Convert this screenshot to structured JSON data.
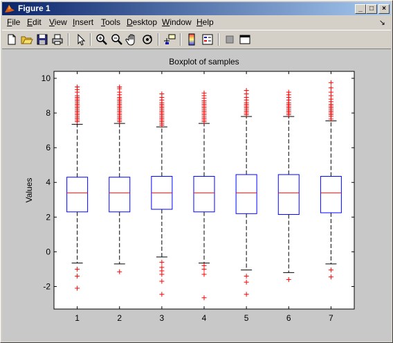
{
  "window": {
    "title": "Figure 1"
  },
  "menu": [
    {
      "pre": "",
      "ul": "F",
      "post": "ile"
    },
    {
      "pre": "",
      "ul": "E",
      "post": "dit"
    },
    {
      "pre": "",
      "ul": "V",
      "post": "iew"
    },
    {
      "pre": "",
      "ul": "I",
      "post": "nsert"
    },
    {
      "pre": "",
      "ul": "T",
      "post": "ools"
    },
    {
      "pre": "",
      "ul": "D",
      "post": "esktop"
    },
    {
      "pre": "",
      "ul": "W",
      "post": "indow"
    },
    {
      "pre": "",
      "ul": "H",
      "post": "elp"
    }
  ],
  "toolbar": {
    "icons": [
      "new-figure-icon",
      "open-file-icon",
      "save-icon",
      "print-icon",
      "edit-plot-arrow-icon",
      "zoom-in-icon",
      "zoom-out-icon",
      "pan-hand-icon",
      "rotate-3d-icon",
      "data-cursor-icon",
      "colorbar-icon",
      "legend-icon",
      "hide-plot-tools-icon",
      "show-plot-tools-icon"
    ]
  },
  "colors": {
    "box": "#0000ff",
    "median": "#ff0000",
    "outlier": "#ff0000",
    "whisker": "#000000"
  },
  "chart_data": {
    "type": "box",
    "title": "Boxplot of samples",
    "xlabel": "",
    "ylabel": "Values",
    "categories": [
      "1",
      "2",
      "3",
      "4",
      "5",
      "6",
      "7"
    ],
    "ylim": [
      -3.3,
      10.4
    ],
    "yticks": [
      -2,
      0,
      2,
      4,
      6,
      8,
      10
    ],
    "grid": false,
    "boxes": [
      {
        "q1": 2.3,
        "median": 3.4,
        "q3": 4.3,
        "whisker_low": -0.65,
        "whisker_high": 7.35
      },
      {
        "q1": 2.3,
        "median": 3.4,
        "q3": 4.3,
        "whisker_low": -0.7,
        "whisker_high": 7.4
      },
      {
        "q1": 2.45,
        "median": 3.4,
        "q3": 4.35,
        "whisker_low": -0.3,
        "whisker_high": 7.2
      },
      {
        "q1": 2.3,
        "median": 3.4,
        "q3": 4.35,
        "whisker_low": -0.65,
        "whisker_high": 7.4
      },
      {
        "q1": 2.2,
        "median": 3.4,
        "q3": 4.45,
        "whisker_low": -1.05,
        "whisker_high": 7.8
      },
      {
        "q1": 2.15,
        "median": 3.4,
        "q3": 4.45,
        "whisker_low": -1.2,
        "whisker_high": 7.8
      },
      {
        "q1": 2.25,
        "median": 3.4,
        "q3": 4.35,
        "whisker_low": -0.7,
        "whisker_high": 7.55
      }
    ],
    "outliers": [
      {
        "low": [
          -1.0,
          -1.4,
          -2.1
        ],
        "high": [
          7.5,
          7.6,
          7.7,
          7.8,
          7.9,
          8.0,
          8.1,
          8.2,
          8.3,
          8.4,
          8.5,
          8.6,
          8.7,
          8.8,
          8.9,
          9.0,
          9.2,
          9.35,
          9.5
        ]
      },
      {
        "low": [
          -1.15
        ],
        "high": [
          7.5,
          7.6,
          7.7,
          7.8,
          7.9,
          8.0,
          8.1,
          8.2,
          8.3,
          8.4,
          8.5,
          8.6,
          8.7,
          8.8,
          8.9,
          9.05,
          9.2,
          9.4,
          9.5
        ]
      },
      {
        "low": [
          -0.6,
          -0.9,
          -1.1,
          -1.3,
          -1.7,
          -2.45
        ],
        "high": [
          7.3,
          7.4,
          7.5,
          7.6,
          7.7,
          7.8,
          7.9,
          8.0,
          8.1,
          8.2,
          8.3,
          8.4,
          8.5,
          8.6,
          8.75,
          8.9,
          9.1
        ]
      },
      {
        "low": [
          -0.8,
          -1.0,
          -1.3,
          -2.65
        ],
        "high": [
          7.5,
          7.6,
          7.7,
          7.8,
          7.9,
          8.0,
          8.1,
          8.2,
          8.3,
          8.4,
          8.5,
          8.6,
          8.7,
          8.85,
          9.0,
          9.15
        ]
      },
      {
        "low": [
          -1.4,
          -1.75,
          -2.45
        ],
        "high": [
          7.9,
          8.0,
          8.1,
          8.2,
          8.3,
          8.4,
          8.5,
          8.6,
          8.75,
          8.9,
          9.1,
          9.3
        ]
      },
      {
        "low": [
          -1.6
        ],
        "high": [
          7.9,
          8.0,
          8.1,
          8.2,
          8.3,
          8.4,
          8.5,
          8.6,
          8.75,
          8.9,
          9.05,
          9.2
        ]
      },
      {
        "low": [
          -1.05,
          -1.45
        ],
        "high": [
          7.65,
          7.8,
          7.9,
          8.0,
          8.1,
          8.2,
          8.3,
          8.4,
          8.5,
          8.65,
          8.8,
          9.0,
          9.2,
          9.45,
          9.75
        ]
      }
    ]
  }
}
